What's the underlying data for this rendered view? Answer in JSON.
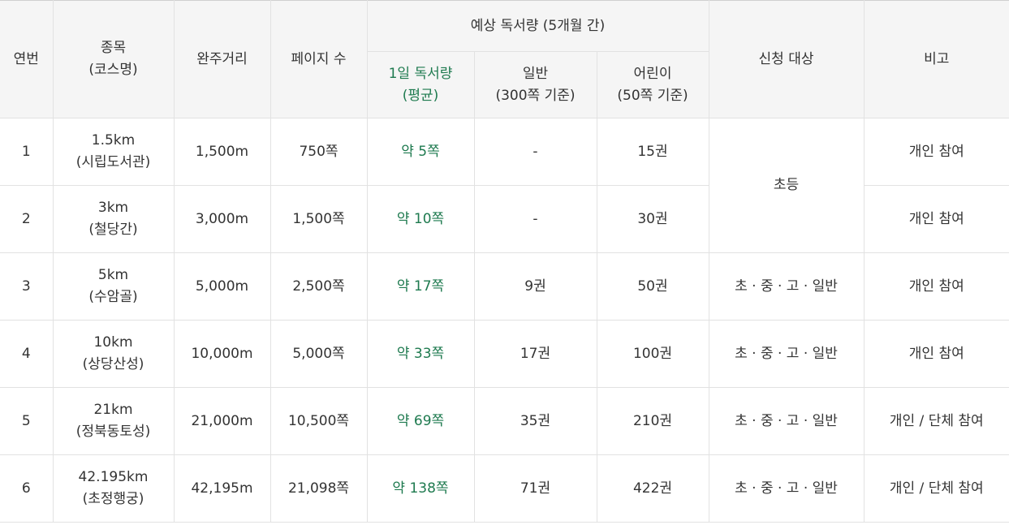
{
  "headers": {
    "no": "연번",
    "course": [
      "종목",
      "(코스명)"
    ],
    "distance": "완주거리",
    "pages": "페이지 수",
    "reading_group": "예상 독서량 (5개월 간)",
    "daily": [
      "1일 독서량",
      "(평균)"
    ],
    "general": [
      "일반",
      "(300쪽 기준)"
    ],
    "children": [
      "어린이",
      "(50쪽 기준)"
    ],
    "target": "신청 대상",
    "note": "비고"
  },
  "rows": [
    {
      "no": "1",
      "course": [
        "1.5km",
        "(시립도서관)"
      ],
      "distance": "1,500m",
      "pages": "750쪽",
      "daily": "약 5쪽",
      "general": "-",
      "children": "15권",
      "target": "초등",
      "note": "개인 참여"
    },
    {
      "no": "2",
      "course": [
        "3km",
        "(철당간)"
      ],
      "distance": "3,000m",
      "pages": "1,500쪽",
      "daily": "약 10쪽",
      "general": "-",
      "children": "30권",
      "target": "초등",
      "note": "개인 참여"
    },
    {
      "no": "3",
      "course": [
        "5km",
        "(수암골)"
      ],
      "distance": "5,000m",
      "pages": "2,500쪽",
      "daily": "약 17쪽",
      "general": "9권",
      "children": "50권",
      "target": "초 · 중 · 고 · 일반",
      "note": "개인 참여"
    },
    {
      "no": "4",
      "course": [
        "10km",
        "(상당산성)"
      ],
      "distance": "10,000m",
      "pages": "5,000쪽",
      "daily": "약 33쪽",
      "general": "17권",
      "children": "100권",
      "target": "초 · 중 · 고 · 일반",
      "note": "개인 참여"
    },
    {
      "no": "5",
      "course": [
        "21km",
        "(정북동토성)"
      ],
      "distance": "21,000m",
      "pages": "10,500쪽",
      "daily": "약 69쪽",
      "general": "35권",
      "children": "210권",
      "target": "초 · 중 · 고 · 일반",
      "note": "개인 / 단체 참여"
    },
    {
      "no": "6",
      "course": [
        "42.195km",
        "(초정행궁)"
      ],
      "distance": "42,195m",
      "pages": "21,098쪽",
      "daily": "약 138쪽",
      "general": "71권",
      "children": "422권",
      "target": "초 · 중 · 고 · 일반",
      "note": "개인 / 단체 참여"
    }
  ],
  "colors": {
    "header_bg": "#f5f5f5",
    "border": "#e2e2e2",
    "daily_text": "#1e7a4f",
    "text": "#333333"
  }
}
